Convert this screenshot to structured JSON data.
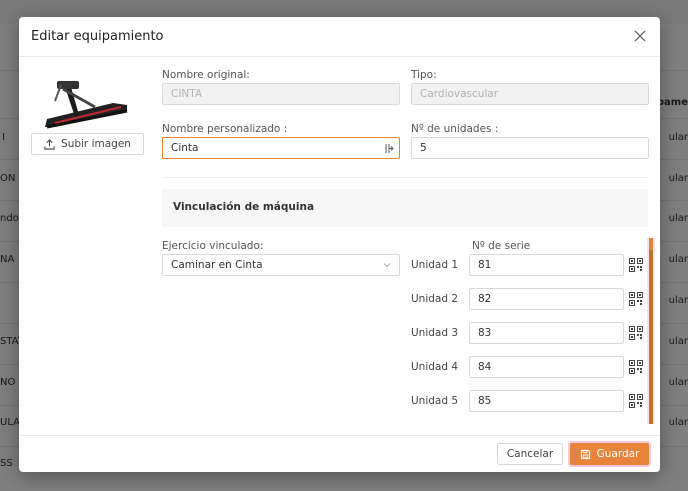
{
  "background": {
    "left_fragments": [
      "I",
      "ON F",
      "ndo",
      "NA",
      "STAT",
      "NO",
      "ULA",
      "SS"
    ],
    "right_fragments": [
      "ipame",
      "ular",
      "ular",
      "ular",
      "ular",
      "ular",
      "ular",
      "ular",
      "ular"
    ]
  },
  "modal": {
    "title": "Editar equipamiento",
    "upload_label": "Subir imagen",
    "original_name": {
      "label": "Nombre original:",
      "value": "CINTA"
    },
    "type": {
      "label": "Tipo:",
      "value": "Cardiovascular"
    },
    "custom_name": {
      "label": "Nombre personalizado :",
      "value": "Cinta"
    },
    "units": {
      "label": "Nº de unidades :",
      "value": "5"
    },
    "section_title": "Vinculación de máquina",
    "linked_exercise": {
      "label": "Ejercicio vinculado:",
      "value": "Caminar en Cinta"
    },
    "serial_header": "Nº de serie",
    "unit_rows": [
      {
        "label": "Unidad 1",
        "serial": "81"
      },
      {
        "label": "Unidad 2",
        "serial": "82"
      },
      {
        "label": "Unidad 3",
        "serial": "83"
      },
      {
        "label": "Unidad 4",
        "serial": "84"
      },
      {
        "label": "Unidad 5",
        "serial": "85"
      }
    ],
    "cancel_label": "Cancelar",
    "save_label": "Guardar"
  },
  "colors": {
    "accent": "#e8833a",
    "scroll_thumb": "#b87a16"
  }
}
